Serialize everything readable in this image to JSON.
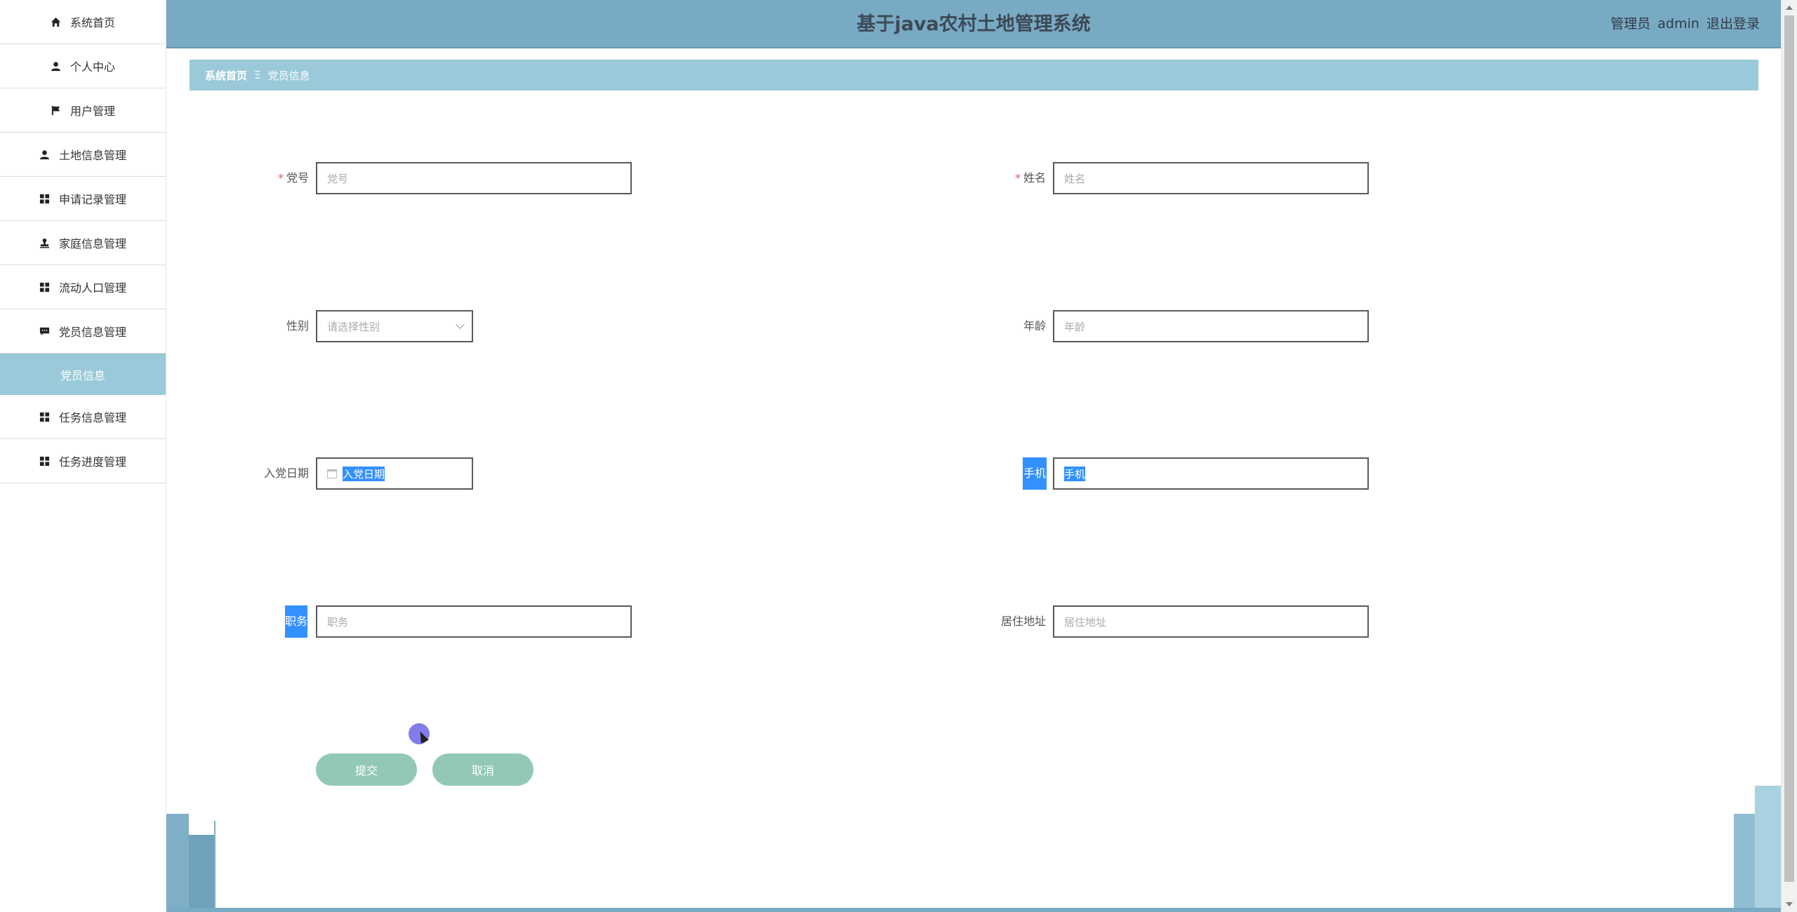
{
  "header": {
    "title": "基于java农村土地管理系统",
    "role": "管理员",
    "username": "admin",
    "logout": "退出登录"
  },
  "sidebar": {
    "items": [
      {
        "label": "系统首页",
        "icon": "home-icon"
      },
      {
        "label": "个人中心",
        "icon": "person-icon"
      },
      {
        "label": "用户管理",
        "icon": "flag-icon"
      },
      {
        "label": "土地信息管理",
        "icon": "person-icon"
      },
      {
        "label": "申请记录管理",
        "icon": "grid-icon"
      },
      {
        "label": "家庭信息管理",
        "icon": "stamp-icon"
      },
      {
        "label": "流动人口管理",
        "icon": "grid-icon"
      },
      {
        "label": "党员信息管理",
        "icon": "chat-icon"
      },
      {
        "label": "任务信息管理",
        "icon": "grid-icon"
      },
      {
        "label": "任务进度管理",
        "icon": "grid-icon"
      }
    ],
    "sub_item": "党员信息"
  },
  "breadcrumb": {
    "home": "系统首页",
    "separator": "Ξ",
    "current": "党员信息"
  },
  "form": {
    "party_no": {
      "label": "党号",
      "placeholder": "党号",
      "required": true
    },
    "name": {
      "label": "姓名",
      "placeholder": "姓名",
      "required": true
    },
    "gender": {
      "label": "性别",
      "placeholder": "请选择性别"
    },
    "age": {
      "label": "年龄",
      "placeholder": "年龄"
    },
    "join_date": {
      "label": "入党日期",
      "placeholder": "入党日期"
    },
    "phone": {
      "label": "手机",
      "placeholder": "手机"
    },
    "position": {
      "label": "职务",
      "placeholder": "职务"
    },
    "address": {
      "label": "居住地址",
      "placeholder": "居住地址"
    },
    "submit": "提交",
    "cancel": "取消",
    "required_mark": "*"
  },
  "colors": {
    "header_bg": "#79aac3",
    "accent": "#9ac9d9",
    "button": "#93c9b4",
    "selection": "#3390ff"
  }
}
